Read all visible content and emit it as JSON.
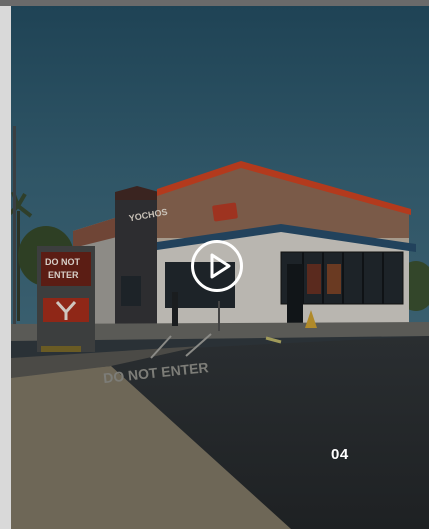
{
  "media": {
    "slide_number": "04",
    "play_icon": "play-icon",
    "sign_text_line1": "DO NOT",
    "sign_text_line2": "ENTER",
    "pavement_text": "DO NOT ENTER",
    "building_sign": "YOCHOS",
    "colors": {
      "sky": "#2f5366",
      "roof_trim": "#c83a1c",
      "sign_red": "#a8321e"
    }
  }
}
